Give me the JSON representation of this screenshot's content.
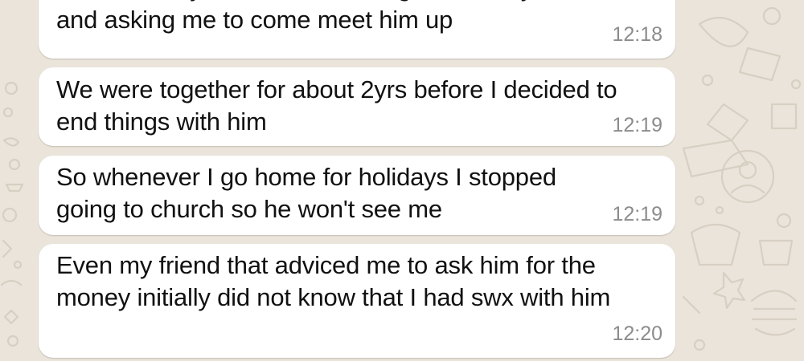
{
  "chat": {
    "background_color": "#ebe4da",
    "bubble_color": "#ffffff",
    "messages": [
      {
        "text": "After that day he started sending me money at will\nand asking me to come meet him up",
        "time": "12:18"
      },
      {
        "text": "We were together for about 2yrs before I decided to\nend things with him",
        "time": "12:19"
      },
      {
        "text": "So whenever I go home for holidays I stopped\ngoing to church so he won't see me",
        "time": "12:19"
      },
      {
        "text": "Even my friend that adviced me to ask him for the\nmoney initially did not know that I had swx with him",
        "time": "12:20"
      }
    ]
  }
}
